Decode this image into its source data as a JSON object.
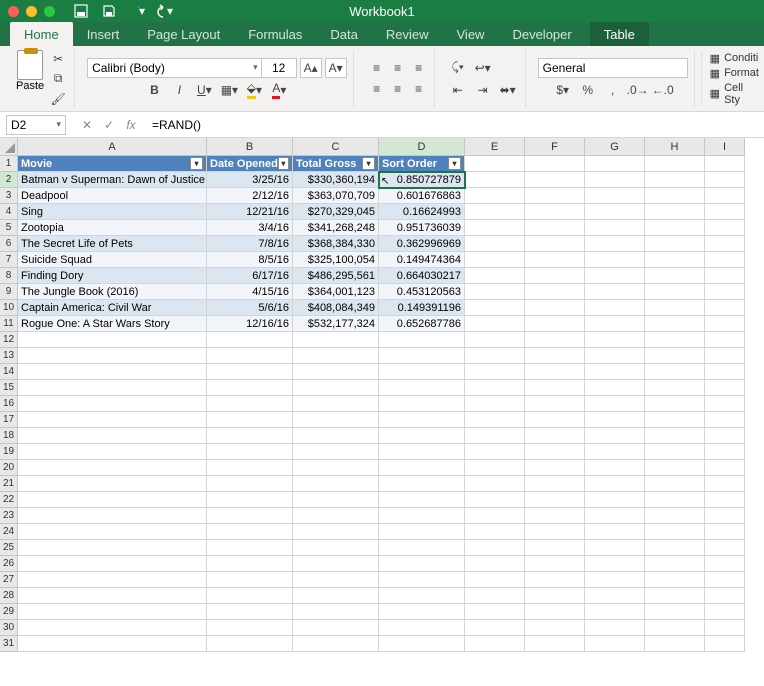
{
  "window": {
    "title": "Workbook1"
  },
  "qat": {
    "save": "save-icon",
    "undo": "undo-icon",
    "redo": "redo-icon"
  },
  "tabs": [
    "Home",
    "Insert",
    "Page Layout",
    "Formulas",
    "Data",
    "Review",
    "View",
    "Developer",
    "Table"
  ],
  "active_tab": "Home",
  "context_tab": "Table",
  "font": {
    "name": "Calibri (Body)",
    "size": "12"
  },
  "paste_label": "Paste",
  "number_format": "General",
  "right_items": [
    "Conditi",
    "Format",
    "Cell Sty"
  ],
  "name_box": "D2",
  "formula": "=RAND()",
  "columns": [
    "A",
    "B",
    "C",
    "D",
    "E",
    "F",
    "G",
    "H",
    "I"
  ],
  "selected_col": "D",
  "selected_row": 2,
  "row_count": 31,
  "headers": [
    "Movie",
    "Date Opened",
    "Total Gross",
    "Sort Order"
  ],
  "chart_data": {
    "type": "table",
    "columns": [
      "Movie",
      "Date Opened",
      "Total Gross",
      "Sort Order"
    ],
    "rows": [
      {
        "movie": "Batman v Superman: Dawn of Justice",
        "date": "3/25/16",
        "gross": "$330,360,194",
        "sort": "0.850727879"
      },
      {
        "movie": "Deadpool",
        "date": "2/12/16",
        "gross": "$363,070,709",
        "sort": "0.601676863"
      },
      {
        "movie": "Sing",
        "date": "12/21/16",
        "gross": "$270,329,045",
        "sort": "0.16624993"
      },
      {
        "movie": "Zootopia",
        "date": "3/4/16",
        "gross": "$341,268,248",
        "sort": "0.951736039"
      },
      {
        "movie": "The Secret Life of Pets",
        "date": "7/8/16",
        "gross": "$368,384,330",
        "sort": "0.362996969"
      },
      {
        "movie": "Suicide Squad",
        "date": "8/5/16",
        "gross": "$325,100,054",
        "sort": "0.149474364"
      },
      {
        "movie": "Finding Dory",
        "date": "6/17/16",
        "gross": "$486,295,561",
        "sort": "0.664030217"
      },
      {
        "movie": "The Jungle Book (2016)",
        "date": "4/15/16",
        "gross": "$364,001,123",
        "sort": "0.453120563"
      },
      {
        "movie": "Captain America: Civil War",
        "date": "5/6/16",
        "gross": "$408,084,349",
        "sort": "0.149391196"
      },
      {
        "movie": "Rogue One: A Star Wars Story",
        "date": "12/16/16",
        "gross": "$532,177,324",
        "sort": "0.652687786"
      }
    ]
  }
}
